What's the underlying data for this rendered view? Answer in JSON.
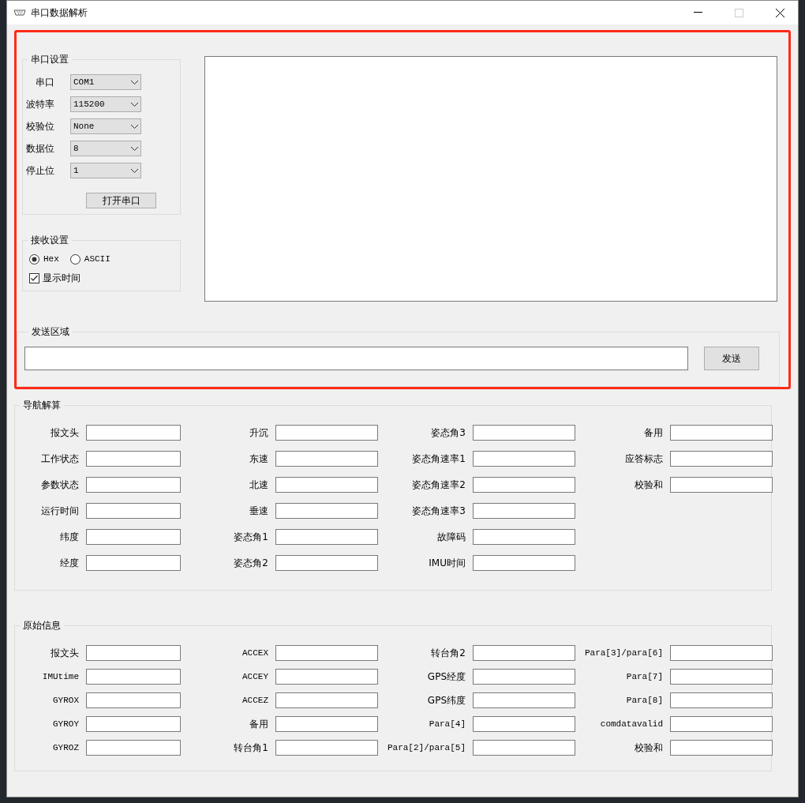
{
  "window": {
    "title": "串口数据解析"
  },
  "serial_settings": {
    "title": "串口设置",
    "fields": [
      {
        "label": "串口",
        "value": "COM1"
      },
      {
        "label": "波特率",
        "value": "115200"
      },
      {
        "label": "校验位",
        "value": "None"
      },
      {
        "label": "数据位",
        "value": "8"
      },
      {
        "label": "停止位",
        "value": "1"
      }
    ],
    "open_button": "打开串口"
  },
  "receive_settings": {
    "title": "接收设置",
    "formats": [
      {
        "label": "Hex",
        "selected": true
      },
      {
        "label": "ASCII",
        "selected": false
      }
    ],
    "show_time": {
      "label": "显示时间",
      "checked": true
    }
  },
  "send_area": {
    "title": "发送区域",
    "button": "发送"
  },
  "nav_solution": {
    "title": "导航解算",
    "columns": [
      [
        "报文头",
        "工作状态",
        "参数状态",
        "运行时间",
        "纬度",
        "经度"
      ],
      [
        "升沉",
        "东速",
        "北速",
        "垂速",
        "姿态角1",
        "姿态角2"
      ],
      [
        "姿态角3",
        "姿态角速率1",
        "姿态角速率2",
        "姿态角速率3",
        "故障码",
        "IMU时间"
      ],
      [
        "备用",
        "应答标志",
        "校验和"
      ]
    ]
  },
  "raw_info": {
    "title": "原始信息",
    "columns": [
      [
        "报文头",
        "IMUtime",
        "GYROX",
        "GYROY",
        "GYROZ"
      ],
      [
        "ACCEX",
        "ACCEY",
        "ACCEZ",
        "备用",
        "转台角1"
      ],
      [
        "转台角2",
        "GPS经度",
        "GPS纬度",
        "Para[4]",
        "Para[2]/para[5]"
      ],
      [
        "Para[3]/para[6]",
        "Para[7]",
        "Para[8]",
        "comdatavalid",
        "校验和"
      ]
    ]
  }
}
